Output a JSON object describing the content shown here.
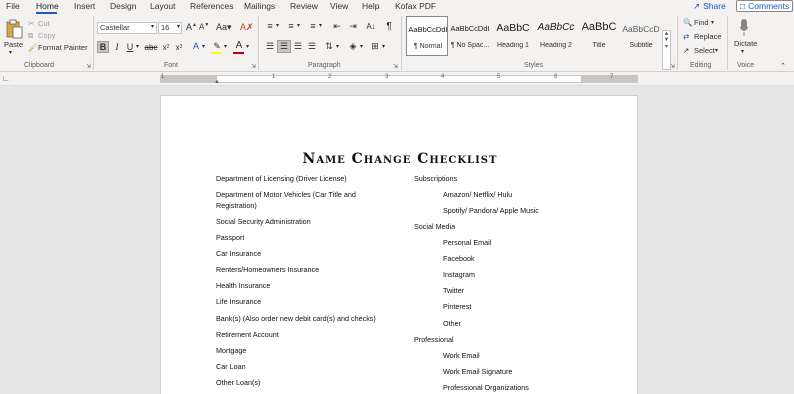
{
  "menu": {
    "tabs": [
      "File",
      "Home",
      "Insert",
      "Design",
      "Layout",
      "References",
      "Mailings",
      "Review",
      "View",
      "Help",
      "Kofax PDF"
    ],
    "share_label": "Share",
    "comments_label": "Comments"
  },
  "ribbon": {
    "clipboard": {
      "paste_label": "Paste",
      "cut_label": "Cut",
      "copy_label": "Copy",
      "format_painter_label": "Format Painter",
      "group_label": "Clipboard"
    },
    "font": {
      "font_name": "Castellar",
      "font_size": "16",
      "group_label": "Font"
    },
    "paragraph": {
      "group_label": "Paragraph"
    },
    "styles": {
      "items": [
        {
          "sample": "AaBbCcDdI",
          "name": "¶ Normal"
        },
        {
          "sample": "AaBbCcDdI",
          "name": "¶ No Spac..."
        },
        {
          "sample": "AaBbC",
          "name": "Heading 1"
        },
        {
          "sample": "AaBbCc",
          "name": "Heading 2"
        },
        {
          "sample": "AaBbC",
          "name": "Title"
        },
        {
          "sample": "AaBbCcD",
          "name": "Subtitle"
        }
      ],
      "group_label": "Styles"
    },
    "editing": {
      "find_label": "Find",
      "replace_label": "Replace",
      "select_label": "Select",
      "group_label": "Editing"
    },
    "voice": {
      "dictate_label": "Dictate",
      "group_label": "Voice"
    }
  },
  "ruler": {
    "numbers": [
      "1",
      "1",
      "2",
      "3",
      "4",
      "5",
      "6",
      "7"
    ]
  },
  "document": {
    "title": "Name Change Checklist",
    "left_column": [
      "Department of Licensing (Driver License)",
      "Department of Motor Vehicles (Car Title and",
      "Registration)",
      "Social Security Administration",
      "Passport",
      "Car Insurance",
      "Renters/Homeowners Insurance",
      "Health Insurance",
      "Life Insurance",
      "Bank(s) (Also order new debit card(s) and checks)",
      "Retirement Account",
      "Mortgage",
      "Car Loan",
      "Other Loan(s)"
    ],
    "right_column": [
      {
        "text": "Subscriptions",
        "indent": false
      },
      {
        "text": "Amazon/ Netflix/ Hulu",
        "indent": true
      },
      {
        "text": "Spotify/ Pandora/ Apple Music",
        "indent": true
      },
      {
        "text": "Social Media",
        "indent": false
      },
      {
        "text": "Personal Email",
        "indent": true
      },
      {
        "text": "Facebook",
        "indent": true
      },
      {
        "text": "Instagram",
        "indent": true
      },
      {
        "text": "Twitter",
        "indent": true
      },
      {
        "text": "Pinterest",
        "indent": true
      },
      {
        "text": "Other",
        "indent": true
      },
      {
        "text": "Professional",
        "indent": false
      },
      {
        "text": "Work Email",
        "indent": true
      },
      {
        "text": "Work Email Signature",
        "indent": true
      },
      {
        "text": "Professional Organizations",
        "indent": true
      }
    ]
  },
  "colors": {
    "accent": "#185abd",
    "font_color_bar": "#c00000",
    "highlight_bar": "#ffff00"
  }
}
